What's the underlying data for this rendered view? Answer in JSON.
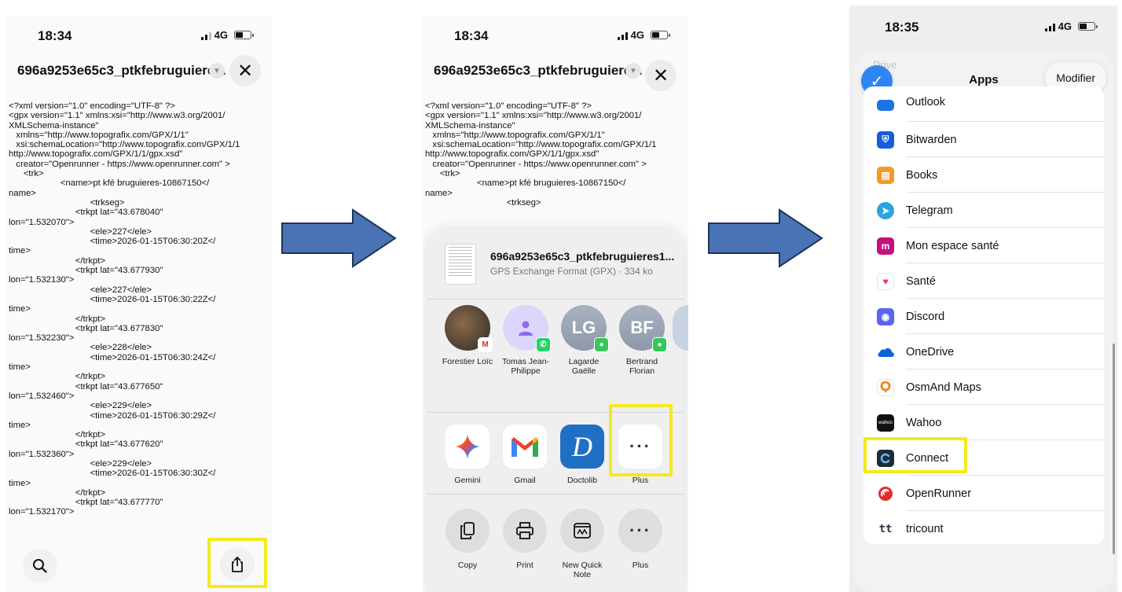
{
  "phone1": {
    "status": {
      "time": "18:34",
      "network": "4G"
    },
    "file_title": "696a9253e65c3_ptkfebruguiere...",
    "xml_lines": [
      "<?xml version=\"1.0\" encoding=\"UTF-8\" ?>",
      "<gpx version=\"1.1\" xmlns:xsi=\"http://www.w3.org/2001/",
      "XMLSchema-instance\"",
      "   xmlns=\"http://www.topografix.com/GPX/1/1\"",
      "   xsi:schemaLocation=\"http://www.topografix.com/GPX/1/1",
      "http://www.topografix.com/GPX/1/1/gpx.xsd\"",
      "   creator=\"Openrunner - https://www.openrunner.com\" >",
      "      <trk>",
      "                     <name>pt kfé bruguieres-10867150</",
      "name>",
      "                                 <trkseg>",
      "                           <trkpt lat=\"43.678040\"",
      "lon=\"1.532070\">",
      "                                 <ele>227</ele>",
      "                                 <time>2026-01-15T06:30:20Z</",
      "time>",
      "                           </trkpt>",
      "                           <trkpt lat=\"43.677930\"",
      "lon=\"1.532130\">",
      "                                 <ele>227</ele>",
      "                                 <time>2026-01-15T06:30:22Z</",
      "time>",
      "                           </trkpt>",
      "                           <trkpt lat=\"43.677830\"",
      "lon=\"1.532230\">",
      "                                 <ele>228</ele>",
      "                                 <time>2026-01-15T06:30:24Z</",
      "time>",
      "                           </trkpt>",
      "                           <trkpt lat=\"43.677650\"",
      "lon=\"1.532460\">",
      "                                 <ele>229</ele>",
      "                                 <time>2026-01-15T06:30:29Z</",
      "time>",
      "                           </trkpt>",
      "                           <trkpt lat=\"43.677620\"",
      "lon=\"1.532360\">",
      "                                 <ele>229</ele>",
      "                                 <time>2026-01-15T06:30:30Z</",
      "time>",
      "                           </trkpt>",
      "                           <trkpt lat=\"43.677770\"",
      "lon=\"1.532170\">"
    ]
  },
  "phone2": {
    "status": {
      "time": "18:34",
      "network": "4G"
    },
    "file_title": "696a9253e65c3_ptkfebruguiere...",
    "xml_lines": [
      "<?xml version=\"1.0\" encoding=\"UTF-8\" ?>",
      "<gpx version=\"1.1\" xmlns:xsi=\"http://www.w3.org/2001/",
      "XMLSchema-instance\"",
      "   xmlns=\"http://www.topografix.com/GPX/1/1\"",
      "   xsi:schemaLocation=\"http://www.topografix.com/GPX/1/1",
      "http://www.topografix.com/GPX/1/1/gpx.xsd\"",
      "   creator=\"Openrunner - https://www.openrunner.com\" >",
      "      <trk>",
      "                     <name>pt kfé bruguieres-10867150</",
      "name>",
      "                                 <trkseg>"
    ],
    "share": {
      "file_name": "696a9253e65c3_ptkfebruguieres1...",
      "file_meta": "GPS Exchange Format (GPX) · 334 ko",
      "contacts": [
        {
          "name": "Forestier Loïc"
        },
        {
          "name": "Tomas Jean-Philippe"
        },
        {
          "initials": "LG",
          "name": "Lagarde Gaëlle"
        },
        {
          "initials": "BF",
          "name": "Bertrand Florian"
        }
      ],
      "apps": [
        "Gemini",
        "Gmail",
        "Doctolib",
        "Plus"
      ],
      "actions": [
        "Copy",
        "Print",
        "New Quick Note",
        "Plus"
      ]
    }
  },
  "phone3": {
    "status": {
      "time": "18:35",
      "network": "4G"
    },
    "sheet_title": "Apps",
    "faded_item": "Drive",
    "edit_label": "Modifier",
    "apps": [
      "Outlook",
      "Bitwarden",
      "Books",
      "Telegram",
      "Mon espace santé",
      "Santé",
      "Discord",
      "OneDrive",
      "OsmAnd Maps",
      "Wahoo",
      "Connect",
      "OpenRunner",
      "tricount"
    ]
  },
  "colors": {
    "highlight": "#f4ea1b",
    "arrow_fill": "#4a73b5",
    "arrow_stroke": "#1d3557",
    "ios_blue": "#2f86f0"
  }
}
